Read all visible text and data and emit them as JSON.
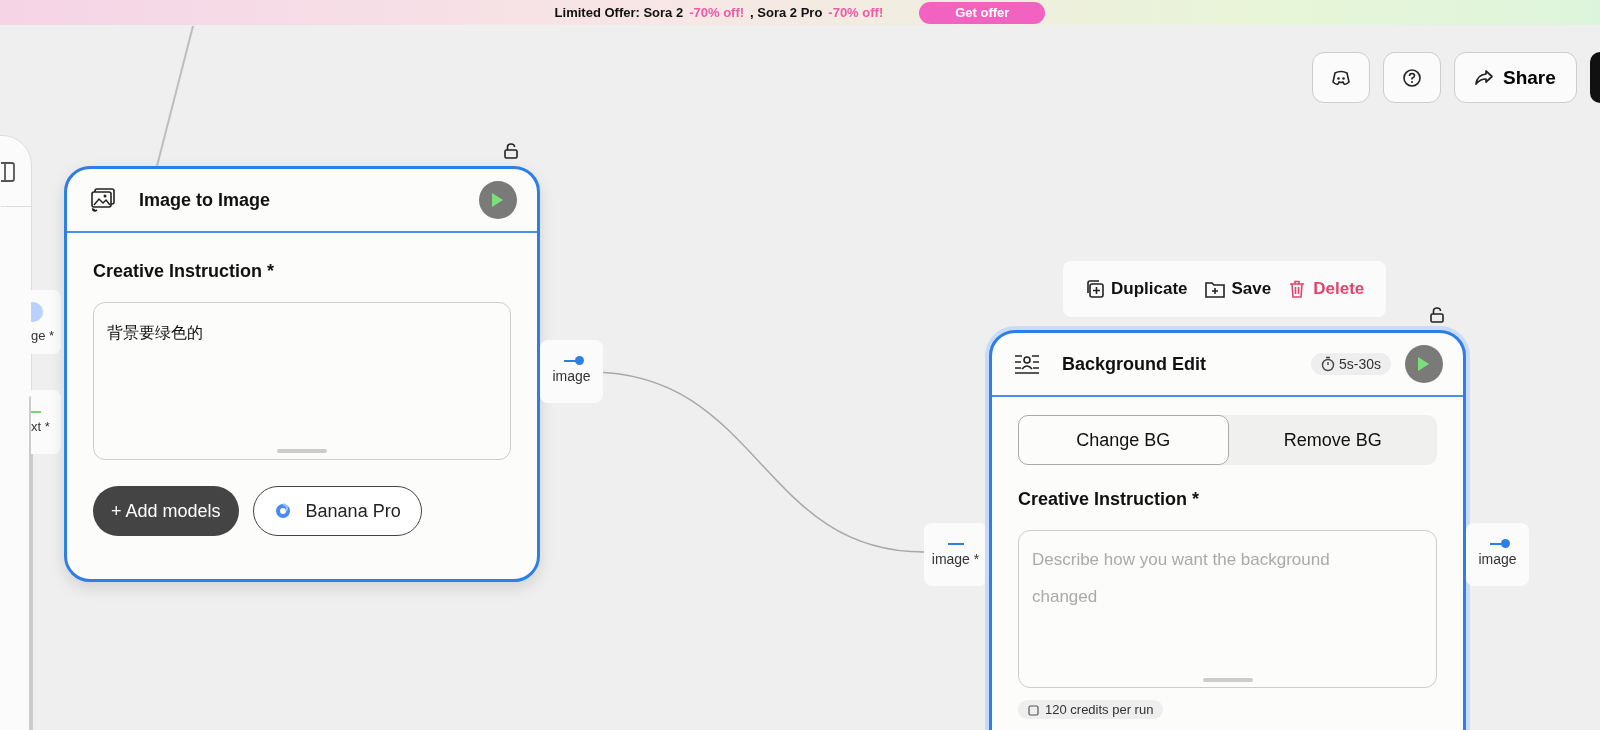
{
  "banner": {
    "parts": [
      {
        "text": "Limited Offer: Sora 2",
        "kind": "plain"
      },
      {
        "text": "-70% off!",
        "kind": "accent"
      },
      {
        "text": ", Sora 2 Pro",
        "kind": "plain"
      },
      {
        "text": "-70% off!",
        "kind": "accent"
      }
    ],
    "button": "Get offer"
  },
  "top_buttons": {
    "share": "Share"
  },
  "left_ports": [
    {
      "label": "ge *",
      "kind": "image"
    },
    {
      "label": "xt *",
      "kind": "text"
    }
  ],
  "nodes": [
    {
      "title": "Image to Image",
      "kind": "image",
      "field_label": "Creative Instruction *",
      "value": "背景要绿色的",
      "add_models": "+ Add models",
      "model": "Banana Pro",
      "output": "image"
    },
    {
      "title": "Background Edit",
      "kind": "background",
      "badge": "5s-30s",
      "toolbar": [
        "Duplicate",
        "Save",
        "Delete"
      ],
      "tabs": [
        {
          "label": "Change BG",
          "selected": true
        },
        {
          "label": "Remove BG",
          "selected": false
        }
      ],
      "field_label": "Creative Instruction *",
      "placeholder": "Describe how you want the background changed",
      "input": "image *",
      "output": "image",
      "credits": "120 credits per run"
    }
  ]
}
